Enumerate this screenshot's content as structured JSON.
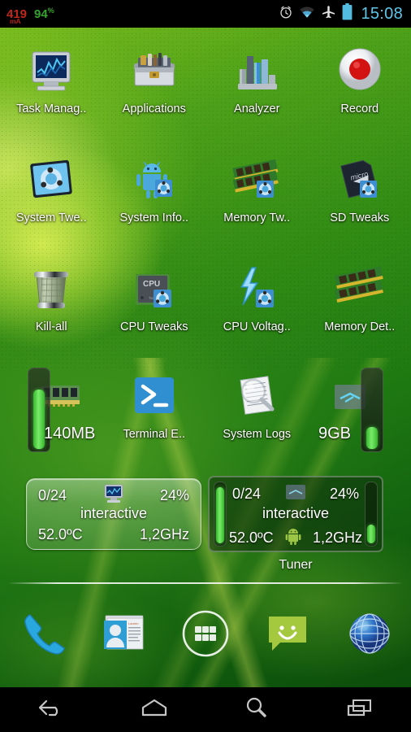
{
  "status_bar": {
    "current_value": "419",
    "current_unit": "mA",
    "battery_value": "94",
    "battery_unit": "%",
    "time": "15:08",
    "icons": [
      "alarm-clock-icon",
      "wifi-icon",
      "airplane-mode-icon",
      "battery-icon"
    ],
    "current_color": "#c0271d",
    "battery_color": "#33a62a",
    "time_color": "#5ec6e8"
  },
  "home": {
    "rows": [
      {
        "items": [
          {
            "label": "Task Manag..",
            "icon": "monitor-chart-icon"
          },
          {
            "label": "Applications",
            "icon": "toolbox-icon"
          },
          {
            "label": "Analyzer",
            "icon": "bar-chart-icon"
          },
          {
            "label": "Record",
            "icon": "record-button-icon"
          }
        ]
      },
      {
        "items": [
          {
            "label": "System Twe..",
            "icon": "ubuntu-gear-tablet-icon"
          },
          {
            "label": "System Info..",
            "icon": "android-gear-icon"
          },
          {
            "label": "Memory Tw..",
            "icon": "ram-gear-icon"
          },
          {
            "label": "SD Tweaks",
            "icon": "microsd-gear-icon"
          }
        ]
      },
      {
        "items": [
          {
            "label": "Kill-all",
            "icon": "trash-bin-icon"
          },
          {
            "label": "CPU Tweaks",
            "icon": "cpu-gear-icon"
          },
          {
            "label": "CPU Voltag..",
            "icon": "lightning-gear-icon"
          },
          {
            "label": "Memory Det..",
            "icon": "ram-stick-icon"
          }
        ]
      },
      {
        "items": [
          {
            "label": "",
            "icon": "ram-module-icon"
          },
          {
            "label": "Terminal E..",
            "icon": "terminal-icon"
          },
          {
            "label": "System Logs",
            "icon": "magnifier-document-icon"
          },
          {
            "label": "",
            "icon": "sdcard-icon"
          }
        ]
      }
    ],
    "ram_gauge": {
      "label": "140MB",
      "fill_percent": 72,
      "color": "#5ce84f"
    },
    "storage_gauge": {
      "label": "9GB",
      "fill_percent": 26,
      "color": "#5ce84f"
    }
  },
  "widgets": [
    {
      "name": "cpu-tuner-light",
      "cores": "0/24",
      "load": "24%",
      "governor": "interactive",
      "temperature": "52.0ºC",
      "frequency": "1,2GHz",
      "center_icon": "monitor-icon",
      "caption": ""
    },
    {
      "name": "cpu-tuner-dark",
      "cores": "0/24",
      "load": "24%",
      "governor": "interactive",
      "temperature": "52.0ºC",
      "frequency": "1,2GHz",
      "center_icon": "sdcard-icon",
      "bottom_icon": "android-robot-icon",
      "caption": "Tuner",
      "left_bar_percent": 88,
      "right_bar_percent": 30
    }
  ],
  "dock": {
    "items": [
      {
        "name": "phone",
        "icon": "phone-handset-icon"
      },
      {
        "name": "contacts",
        "icon": "contacts-card-icon"
      },
      {
        "name": "app-drawer",
        "icon": "app-drawer-icon"
      },
      {
        "name": "messaging",
        "icon": "message-bubble-icon"
      },
      {
        "name": "browser",
        "icon": "globe-browser-icon"
      }
    ]
  },
  "nav_bar": {
    "items": [
      {
        "name": "back",
        "icon": "back-arrow-icon"
      },
      {
        "name": "home",
        "icon": "home-icon"
      },
      {
        "name": "search",
        "icon": "search-icon"
      },
      {
        "name": "recents",
        "icon": "recent-apps-icon"
      }
    ]
  }
}
